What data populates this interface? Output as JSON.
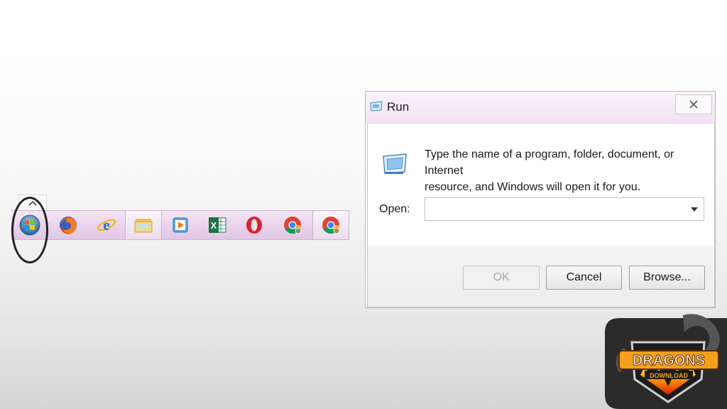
{
  "taskbar": {
    "items": [
      {
        "name": "start-button",
        "icon": "windows-start-orb-icon"
      },
      {
        "name": "firefox",
        "icon": "firefox-icon"
      },
      {
        "name": "internet-explorer",
        "icon": "internet-explorer-icon"
      },
      {
        "name": "file-explorer",
        "icon": "folder-icon"
      },
      {
        "name": "media-player",
        "icon": "media-player-icon"
      },
      {
        "name": "excel",
        "icon": "excel-icon",
        "letter": "X"
      },
      {
        "name": "opera",
        "icon": "opera-icon"
      },
      {
        "name": "chrome-1",
        "icon": "chrome-icon"
      },
      {
        "name": "chrome-2",
        "icon": "chrome-icon"
      }
    ],
    "tray_arrow": "^"
  },
  "dialog": {
    "title": "Run",
    "description_line1": "Type the name of a program, folder, document, or Internet",
    "description_line2": "resource, and Windows will open it for you.",
    "open_label": "Open:",
    "open_value": "",
    "ok_label": "OK",
    "cancel_label": "Cancel",
    "browse_label": "Browse...",
    "close_glyph": "✕"
  },
  "logo": {
    "line1": "DRAGONS",
    "line2": "DOWNLOAD"
  },
  "colors": {
    "taskbar_tint": "#e9d2ec",
    "titlebar_tint": "#f2e2f3",
    "annotation_circle": "#222222"
  }
}
